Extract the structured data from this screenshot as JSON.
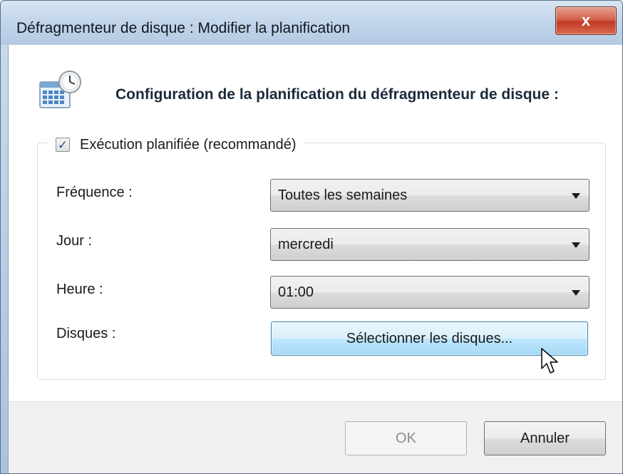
{
  "window": {
    "title": "Défragmenteur de disque : Modifier la planification",
    "close_label": "x"
  },
  "header": {
    "icon": "calendar-clock-icon",
    "title": "Configuration de la planification du défragmenteur de disque :"
  },
  "schedule": {
    "enabled_label": "Exécution planifiée (recommandé)",
    "enabled": true,
    "frequency": {
      "label": "Fréquence :",
      "value": "Toutes les semaines"
    },
    "day": {
      "label": "Jour :",
      "value": "mercredi"
    },
    "time": {
      "label": "Heure :",
      "value": "01:00"
    },
    "disks": {
      "label": "Disques :",
      "button_label": "Sélectionner les disques..."
    }
  },
  "footer": {
    "ok_label": "OK",
    "cancel_label": "Annuler"
  },
  "colors": {
    "title_bar": "#c2d5ea",
    "close_button": "#c23a26",
    "hover_button": "#bee6fd",
    "footer_bg": "#f0f0f0"
  }
}
